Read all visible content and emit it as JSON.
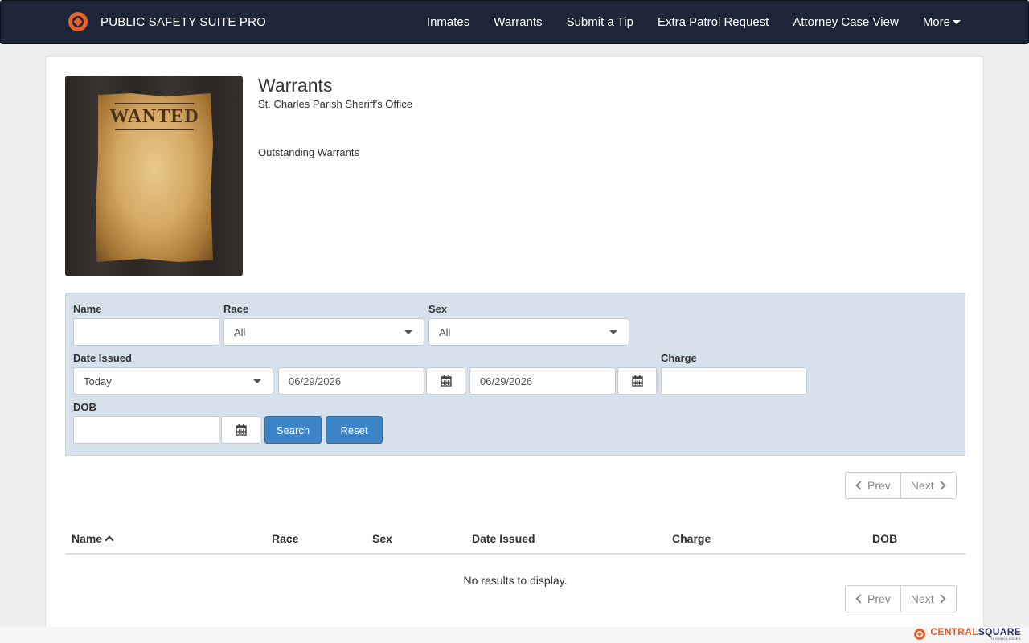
{
  "navbar": {
    "brand": "PUBLIC SAFETY SUITE PRO",
    "items": [
      {
        "label": "Inmates"
      },
      {
        "label": "Warrants"
      },
      {
        "label": "Submit a Tip"
      },
      {
        "label": "Extra Patrol Request"
      },
      {
        "label": "Attorney Case View"
      },
      {
        "label": "More"
      }
    ]
  },
  "header": {
    "image_text": "WANTED",
    "title": "Warrants",
    "subtitle": "St. Charles Parish Sheriff's Office",
    "description": "Outstanding Warrants"
  },
  "filters": {
    "name_label": "Name",
    "name_value": "",
    "race_label": "Race",
    "race_value": "All",
    "sex_label": "Sex",
    "sex_value": "All",
    "date_issued_label": "Date Issued",
    "date_range_value": "Today",
    "date_from": "06/29/2026",
    "date_to": "06/29/2026",
    "charge_label": "Charge",
    "charge_value": "",
    "dob_label": "DOB",
    "dob_value": "",
    "search_label": "Search",
    "reset_label": "Reset"
  },
  "pager": {
    "prev_label": "Prev",
    "next_label": "Next"
  },
  "table": {
    "columns": [
      "Name",
      "Race",
      "Sex",
      "Date Issued",
      "Charge",
      "DOB"
    ],
    "sorted_column": "Name",
    "sort_direction": "ascending",
    "empty_message": "No results to display."
  },
  "footer": {
    "logo_part1": "CENTRAL",
    "logo_part2": "SQUARE",
    "logo_sub": "TECHNOLOGIES"
  },
  "colors": {
    "navbar_bg": "#1c2638",
    "accent_orange": "#e8612c",
    "button_blue": "#3d85c6",
    "filter_bg": "#d7e1ec"
  }
}
